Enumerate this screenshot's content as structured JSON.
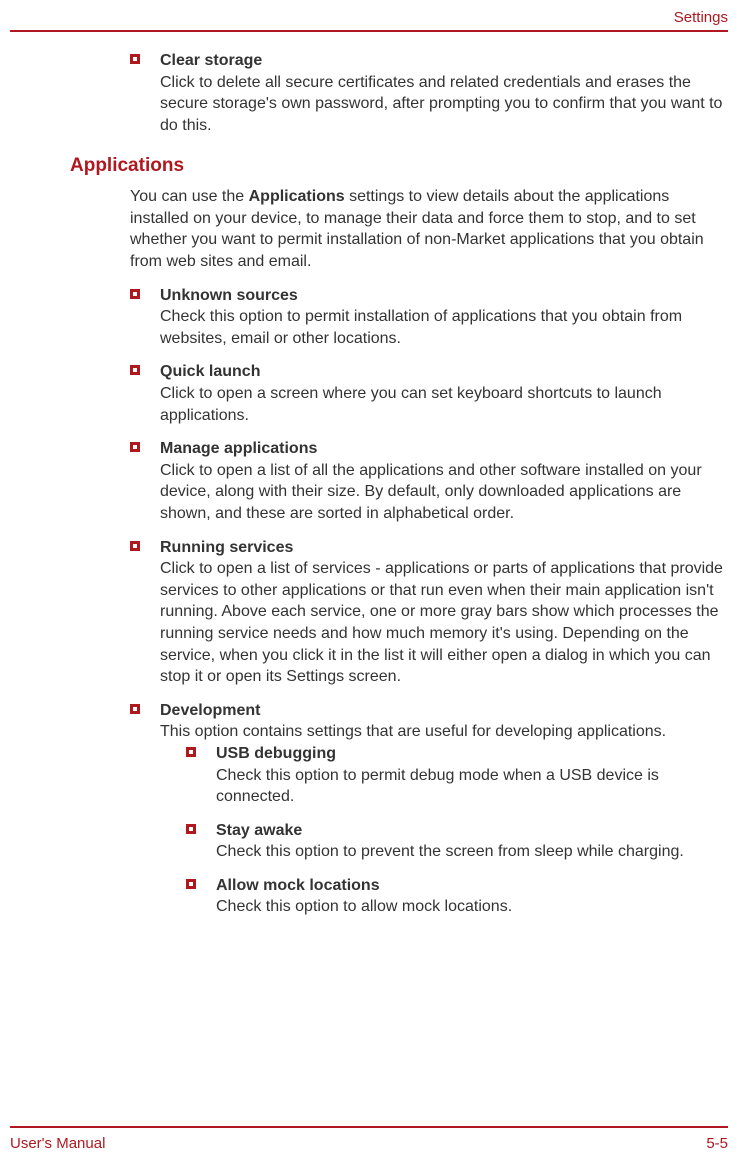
{
  "header": {
    "title": "Settings"
  },
  "items_top": [
    {
      "title": "Clear storage",
      "desc": "Click to delete all secure certificates and related credentials and erases the secure storage's own password, after prompting you to confirm that you want to do this."
    }
  ],
  "section": {
    "heading": "Applications",
    "intro_prefix": "You can use the ",
    "intro_bold": "Applications",
    "intro_suffix": " settings to view details about the applications installed on your device, to manage their data and force them to stop, and to set whether you want to permit installation of non-Market applications that you obtain from web sites and email.",
    "items": [
      {
        "title": "Unknown sources",
        "desc": "Check this option to permit installation of applications that you obtain from websites, email or other locations."
      },
      {
        "title": "Quick launch",
        "desc": "Click to open a screen where you can set keyboard shortcuts to launch applications."
      },
      {
        "title": "Manage applications",
        "desc": "Click to open a list of all the applications and other software installed on your device, along with their size. By default, only downloaded applications are shown, and these are sorted in alphabetical order."
      },
      {
        "title": "Running services",
        "desc": "Click to open a list of services - applications or parts of applications that provide services to other applications or that run even when their main application isn't running. Above each service, one or more gray bars show which processes the running service needs and how much memory it's using. Depending on the service, when you click it in the list it will either open a dialog in which you can stop it or open its Settings screen."
      },
      {
        "title": "Development",
        "desc": "This option contains settings that are useful for developing applications.",
        "subitems": [
          {
            "title": "USB debugging",
            "desc": "Check this option to permit debug mode when a USB device is connected."
          },
          {
            "title": "Stay awake",
            "desc": "Check this option to prevent the screen from sleep while charging."
          },
          {
            "title": "Allow mock locations",
            "desc": "Check this option to allow mock locations."
          }
        ]
      }
    ]
  },
  "footer": {
    "left": "User's Manual",
    "right": "5-5"
  }
}
